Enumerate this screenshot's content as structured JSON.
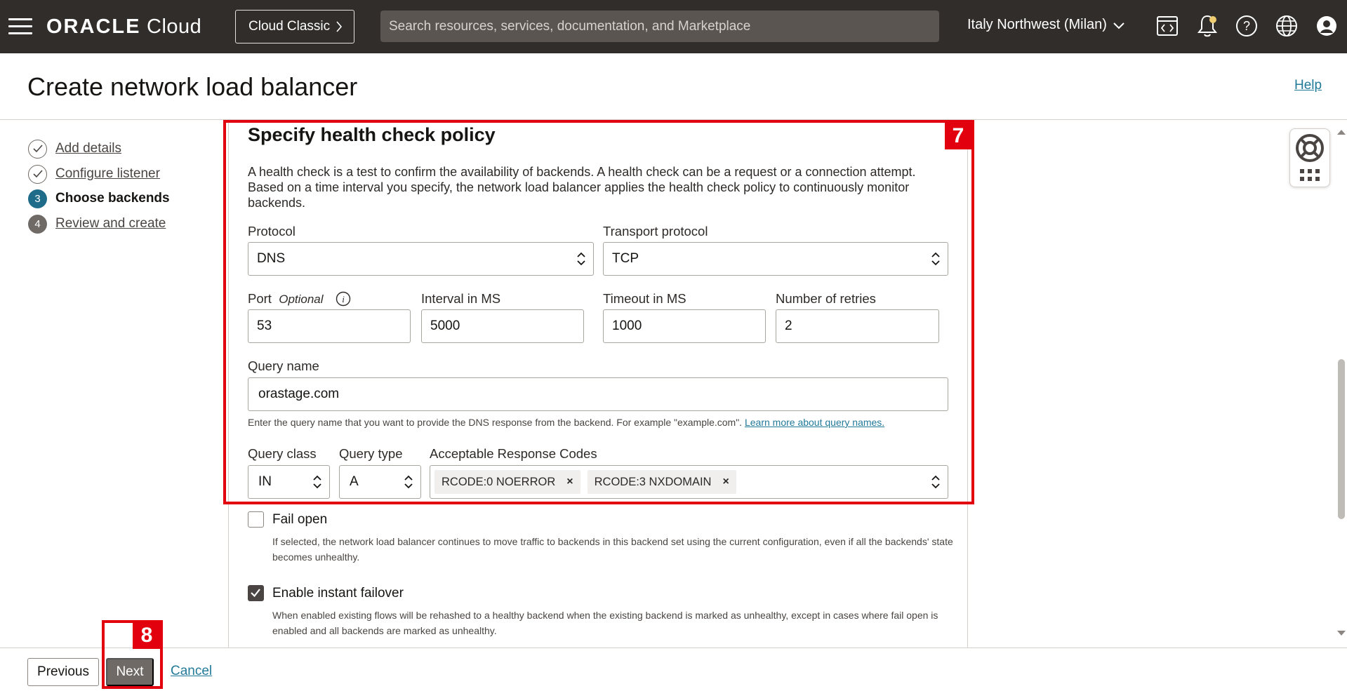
{
  "topnav": {
    "logo_main": "ORACLE",
    "logo_sub": "Cloud",
    "classic_label": "Cloud Classic",
    "search_placeholder": "Search resources, services, documentation, and Marketplace",
    "region": "Italy Northwest (Milan)",
    "icons": [
      "menu-icon",
      "code-editor-icon",
      "bell-icon",
      "help-icon",
      "globe-icon",
      "user-icon"
    ]
  },
  "header": {
    "title": "Create network load balancer",
    "help": "Help"
  },
  "steps": [
    {
      "num": "1",
      "label": "Add details",
      "state": "done"
    },
    {
      "num": "2",
      "label": "Configure listener",
      "state": "done"
    },
    {
      "num": "3",
      "label": "Choose backends",
      "state": "current"
    },
    {
      "num": "4",
      "label": "Review and create",
      "state": "todo"
    }
  ],
  "health_check": {
    "title": "Specify health check policy",
    "description": "A health check is a test to confirm the availability of backends. A health check can be a request or a connection attempt. Based on a time interval you specify, the network load balancer applies the health check policy to continuously monitor backends.",
    "protocol_label": "Protocol",
    "protocol_value": "DNS",
    "transport_label": "Transport protocol",
    "transport_value": "TCP",
    "port_label": "Port",
    "port_optional": "Optional",
    "port_value": "53",
    "interval_label": "Interval in MS",
    "interval_value": "5000",
    "timeout_label": "Timeout in MS",
    "timeout_value": "1000",
    "retries_label": "Number of retries",
    "retries_value": "2",
    "query_name_label": "Query name",
    "query_name_value": "orastage.com",
    "query_name_hint": "Enter the query name that you want to provide the DNS response from the backend. For example \"example.com\".",
    "query_name_link": "Learn more about query names.",
    "query_class_label": "Query class",
    "query_class_value": "IN",
    "query_type_label": "Query type",
    "query_type_value": "A",
    "response_codes_label": "Acceptable Response Codes",
    "response_codes": [
      "RCODE:0 NOERROR",
      "RCODE:3 NXDOMAIN"
    ]
  },
  "options": {
    "fail_open_label": "Fail open",
    "fail_open_checked": false,
    "fail_open_help": "If selected, the network load balancer continues to move traffic to backends in this backend set using the current configuration, even if all the backends' state becomes unhealthy.",
    "failover_label": "Enable instant failover",
    "failover_checked": true,
    "failover_help": "When enabled existing flows will be rehashed to a healthy backend when the existing backend is marked as unhealthy, except in cases where fail open is enabled and all backends are marked as unhealthy."
  },
  "annotations": {
    "box7_tag": "7",
    "box8_tag": "8"
  },
  "footer": {
    "previous": "Previous",
    "next": "Next",
    "cancel": "Cancel"
  },
  "colors": {
    "topbar": "#312d2a",
    "accent_link": "#227a99",
    "annotation_red": "#e2000f",
    "step_current": "#1e6b8a"
  }
}
